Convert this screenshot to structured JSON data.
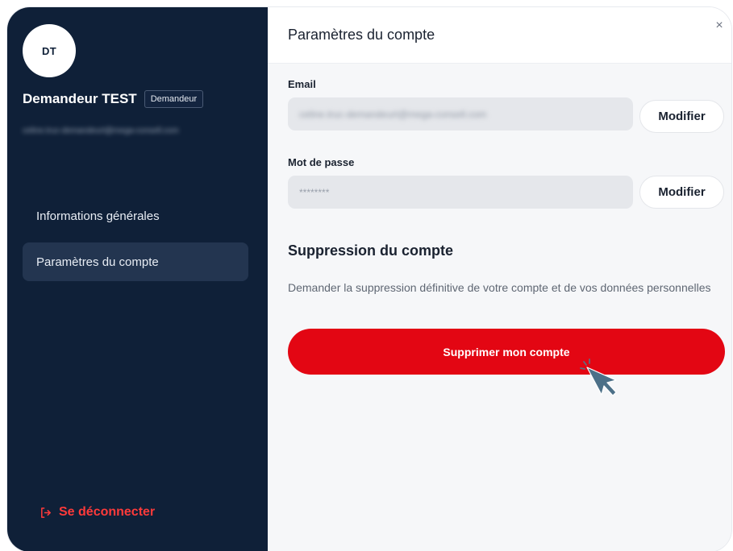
{
  "user": {
    "initials": "DT",
    "name": "Demandeur TEST",
    "role_badge": "Demandeur",
    "email": "celine.truc-demandeurt@mega-consell.com"
  },
  "sidebar": {
    "items": [
      {
        "label": "Informations générales",
        "active": false
      },
      {
        "label": "Paramètres du compte",
        "active": true
      }
    ],
    "logout_label": "Se déconnecter"
  },
  "main": {
    "title": "Paramètres du compte",
    "close_symbol": "×",
    "email": {
      "label": "Email",
      "value": "celine.truc-demandeurt@mega-consell.com",
      "button": "Modifier"
    },
    "password": {
      "label": "Mot de passe",
      "value": "********",
      "button": "Modifier"
    },
    "deletion": {
      "title": "Suppression du compte",
      "description": "Demander la suppression définitive de votre compte et de vos données personnelles",
      "button": "Supprimer mon compte"
    }
  },
  "colors": {
    "sidebar_bg": "#0f2038",
    "active_item_bg": "#233550",
    "danger": "#e30613",
    "logout": "#ff3a3a",
    "panel_bg": "#f6f7f9"
  },
  "icons": {
    "logout": "logout-arrow-icon",
    "close": "close-icon",
    "cursor": "pointer-hand-icon"
  }
}
